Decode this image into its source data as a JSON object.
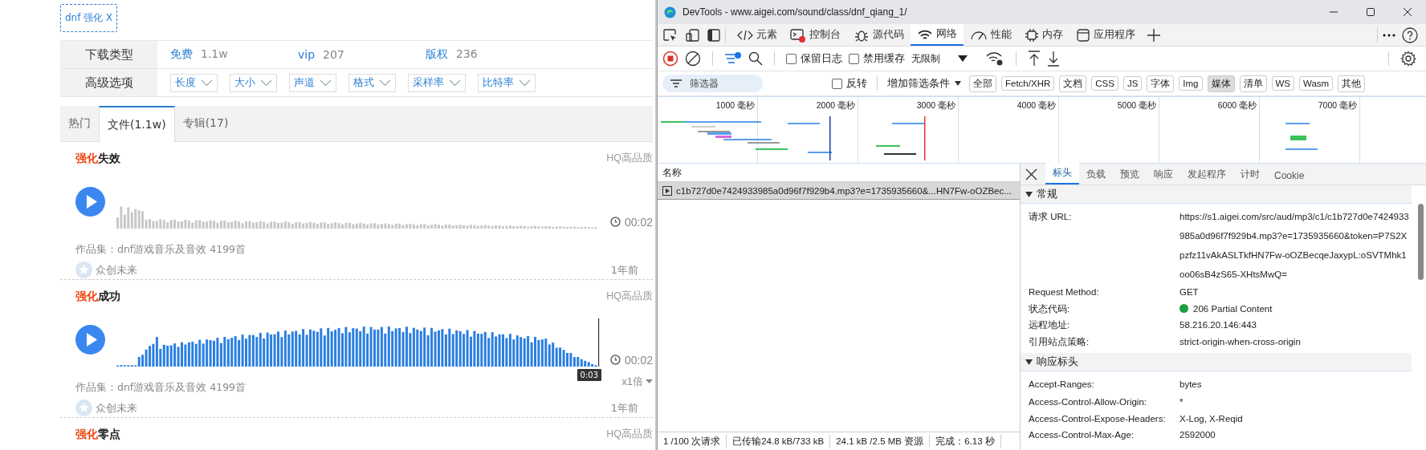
{
  "search_tag": {
    "label": "dnf 强化",
    "remove": "X"
  },
  "filters": [
    {
      "label": "下载类型",
      "kind": "counts",
      "options": [
        {
          "label": "免费",
          "count": "1.1w"
        },
        {
          "label": "vip",
          "count": "207"
        },
        {
          "label": "版权",
          "count": "236"
        }
      ]
    },
    {
      "label": "高级选项",
      "kind": "dropdowns",
      "options": [
        {
          "label": "长度"
        },
        {
          "label": "大小"
        },
        {
          "label": "声道"
        },
        {
          "label": "格式"
        },
        {
          "label": "采样率"
        },
        {
          "label": "比特率"
        }
      ]
    }
  ],
  "tabs": [
    {
      "label": "热门",
      "selected": false
    },
    {
      "label": "文件(1.1w)",
      "selected": true
    },
    {
      "label": "专辑(17)",
      "selected": false
    }
  ],
  "sounds": [
    {
      "keyword": "强化",
      "title": "失效",
      "quality": "HQ高品质",
      "played": false,
      "duration": "00:02",
      "collection": "作品集：dnf游戏音乐及音效 4199首",
      "author": "众创未来",
      "age": "1年前"
    },
    {
      "keyword": "强化",
      "title": "成功",
      "quality": "HQ高品质",
      "played": true,
      "playhead_time": "0:03",
      "duration": "00:02",
      "speed": "x1倍",
      "collection": "作品集：dnf游戏音乐及音效 4199首",
      "author": "众创未来",
      "age": "1年前"
    },
    {
      "keyword": "强化",
      "title": "零点",
      "quality": "HQ高品质"
    }
  ],
  "devtools": {
    "title": "DevTools - www.aigei.com/sound/class/dnf_qiang_1/",
    "panel_tabs": [
      {
        "label": "元素",
        "selected": false
      },
      {
        "label": "控制台",
        "selected": false
      },
      {
        "label": "源代码",
        "selected": false
      },
      {
        "label": "网络",
        "selected": true
      },
      {
        "label": "性能",
        "selected": false
      },
      {
        "label": "内存",
        "selected": false
      },
      {
        "label": "应用程序",
        "selected": false
      }
    ],
    "recording": true,
    "toolbar_checks": [
      {
        "label": "保留日志",
        "checked": false
      },
      {
        "label": "禁用缓存",
        "checked": false
      }
    ],
    "throttle": "无限制",
    "filter": {
      "placeholder": "筛选器",
      "invert": {
        "label": "反转",
        "checked": false
      },
      "more": "增加筛选条件"
    },
    "type_filters": [
      {
        "label": "全部",
        "selected": false
      },
      {
        "label": "Fetch/XHR",
        "selected": false
      },
      {
        "label": "文档",
        "selected": false
      },
      {
        "label": "CSS",
        "selected": false
      },
      {
        "label": "JS",
        "selected": false
      },
      {
        "label": "字体",
        "selected": false
      },
      {
        "label": "Img",
        "selected": false
      },
      {
        "label": "媒体",
        "selected": true
      },
      {
        "label": "清单",
        "selected": false
      },
      {
        "label": "WS",
        "selected": false
      },
      {
        "label": "Wasm",
        "selected": false
      },
      {
        "label": "其他",
        "selected": false
      }
    ],
    "timeline_ticks": [
      "1000 毫秒",
      "2000 毫秒",
      "3000 毫秒",
      "4000 毫秒",
      "5000 毫秒",
      "6000 毫秒",
      "7000 毫秒"
    ],
    "name_header": "名称",
    "requests": [
      {
        "name": "c1b727d0e7424933985a0d96f7f929b4.mp3?e=1735935660&...HN7Fw-oOZBec...",
        "selected": true
      }
    ],
    "detail_tabs": [
      {
        "label": "标头",
        "selected": true
      },
      {
        "label": "负载",
        "selected": false
      },
      {
        "label": "预览",
        "selected": false
      },
      {
        "label": "响应",
        "selected": false
      },
      {
        "label": "发起程序",
        "selected": false
      },
      {
        "label": "计时",
        "selected": false
      },
      {
        "label": "Cookie",
        "selected": false
      }
    ],
    "sections": [
      {
        "title": "常规",
        "expanded": true,
        "rows": [
          {
            "key": "请求 URL:",
            "value": "https://s1.aigei.com/src/aud/mp3/c1/c1b727d0e7424933985a0d96f7f929b4.mp3?e=1735935660&token=P7S2Xpzfz11vAkASLTkfHN7Fw-oOZBecqeJaxypL:oSVTMhk1oo06sB4zS65-XHtsMwQ="
          },
          {
            "key": "Request Method:",
            "value": "GET"
          },
          {
            "key": "状态代码:",
            "value": "206 Partial Content",
            "color": "#1a9e3f"
          },
          {
            "key": "远程地址:",
            "value": "58.216.20.146:443"
          },
          {
            "key": "引用站点策略:",
            "value": "strict-origin-when-cross-origin"
          }
        ]
      },
      {
        "title": "响应标头",
        "expanded": true,
        "rows": [
          {
            "key": "Accept-Ranges:",
            "value": "bytes"
          },
          {
            "key": "Access-Control-Allow-Origin:",
            "value": "*"
          },
          {
            "key": "Access-Control-Expose-Headers:",
            "value": "X-Log, X-Reqid"
          },
          {
            "key": "Access-Control-Max-Age:",
            "value": "2592000"
          }
        ]
      }
    ],
    "status_bar": [
      "1 /100 次请求",
      "已传输24.8 kB/733 kB",
      "24.1 kB /2.5 MB 资源",
      "完成：6.13 秒"
    ]
  }
}
